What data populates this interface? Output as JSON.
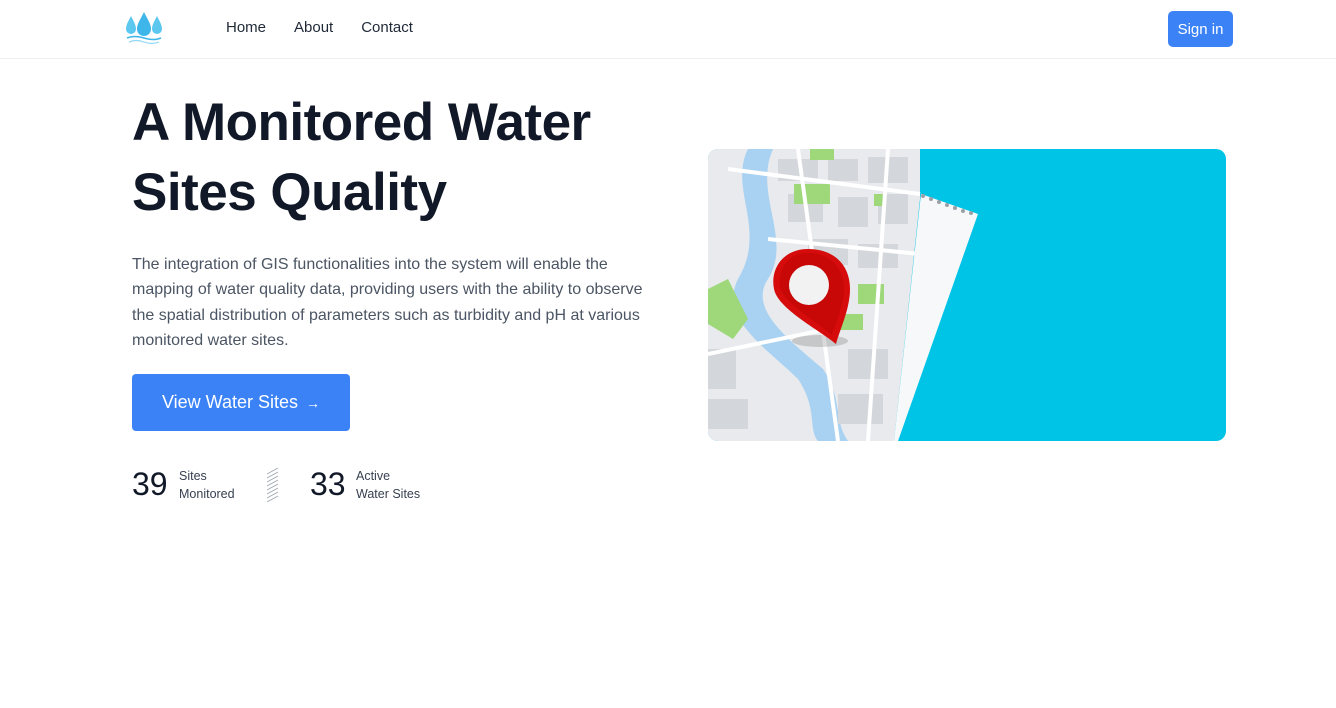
{
  "nav": {
    "logo_icon": "water-drops-logo",
    "links": [
      "Home",
      "About",
      "Contact"
    ],
    "signin_label": "Sign in"
  },
  "hero": {
    "title_line1": "A Monitored Water",
    "title_line2": "Sites Quality",
    "description": "The integration of GIS functionalities into the system will enable the mapping of water quality data, providing users with the ability to observe the spatial distribution of parameters such as turbidity and pH at various monitored water sites.",
    "cta_label": "View Water Sites",
    "cta_icon": "arrow-right-icon",
    "image": "map-with-red-location-pin"
  },
  "stats": [
    {
      "value": "39",
      "label_line1": "Sites",
      "label_line2": "Monitored"
    },
    {
      "value": "33",
      "label_line1": "Active",
      "label_line2": "Water Sites"
    }
  ],
  "colors": {
    "accent": "#3b82f6",
    "title": "#111827",
    "body_text": "#4b5563",
    "image_bg": "#00c4e6",
    "pin": "#d60b0b"
  }
}
